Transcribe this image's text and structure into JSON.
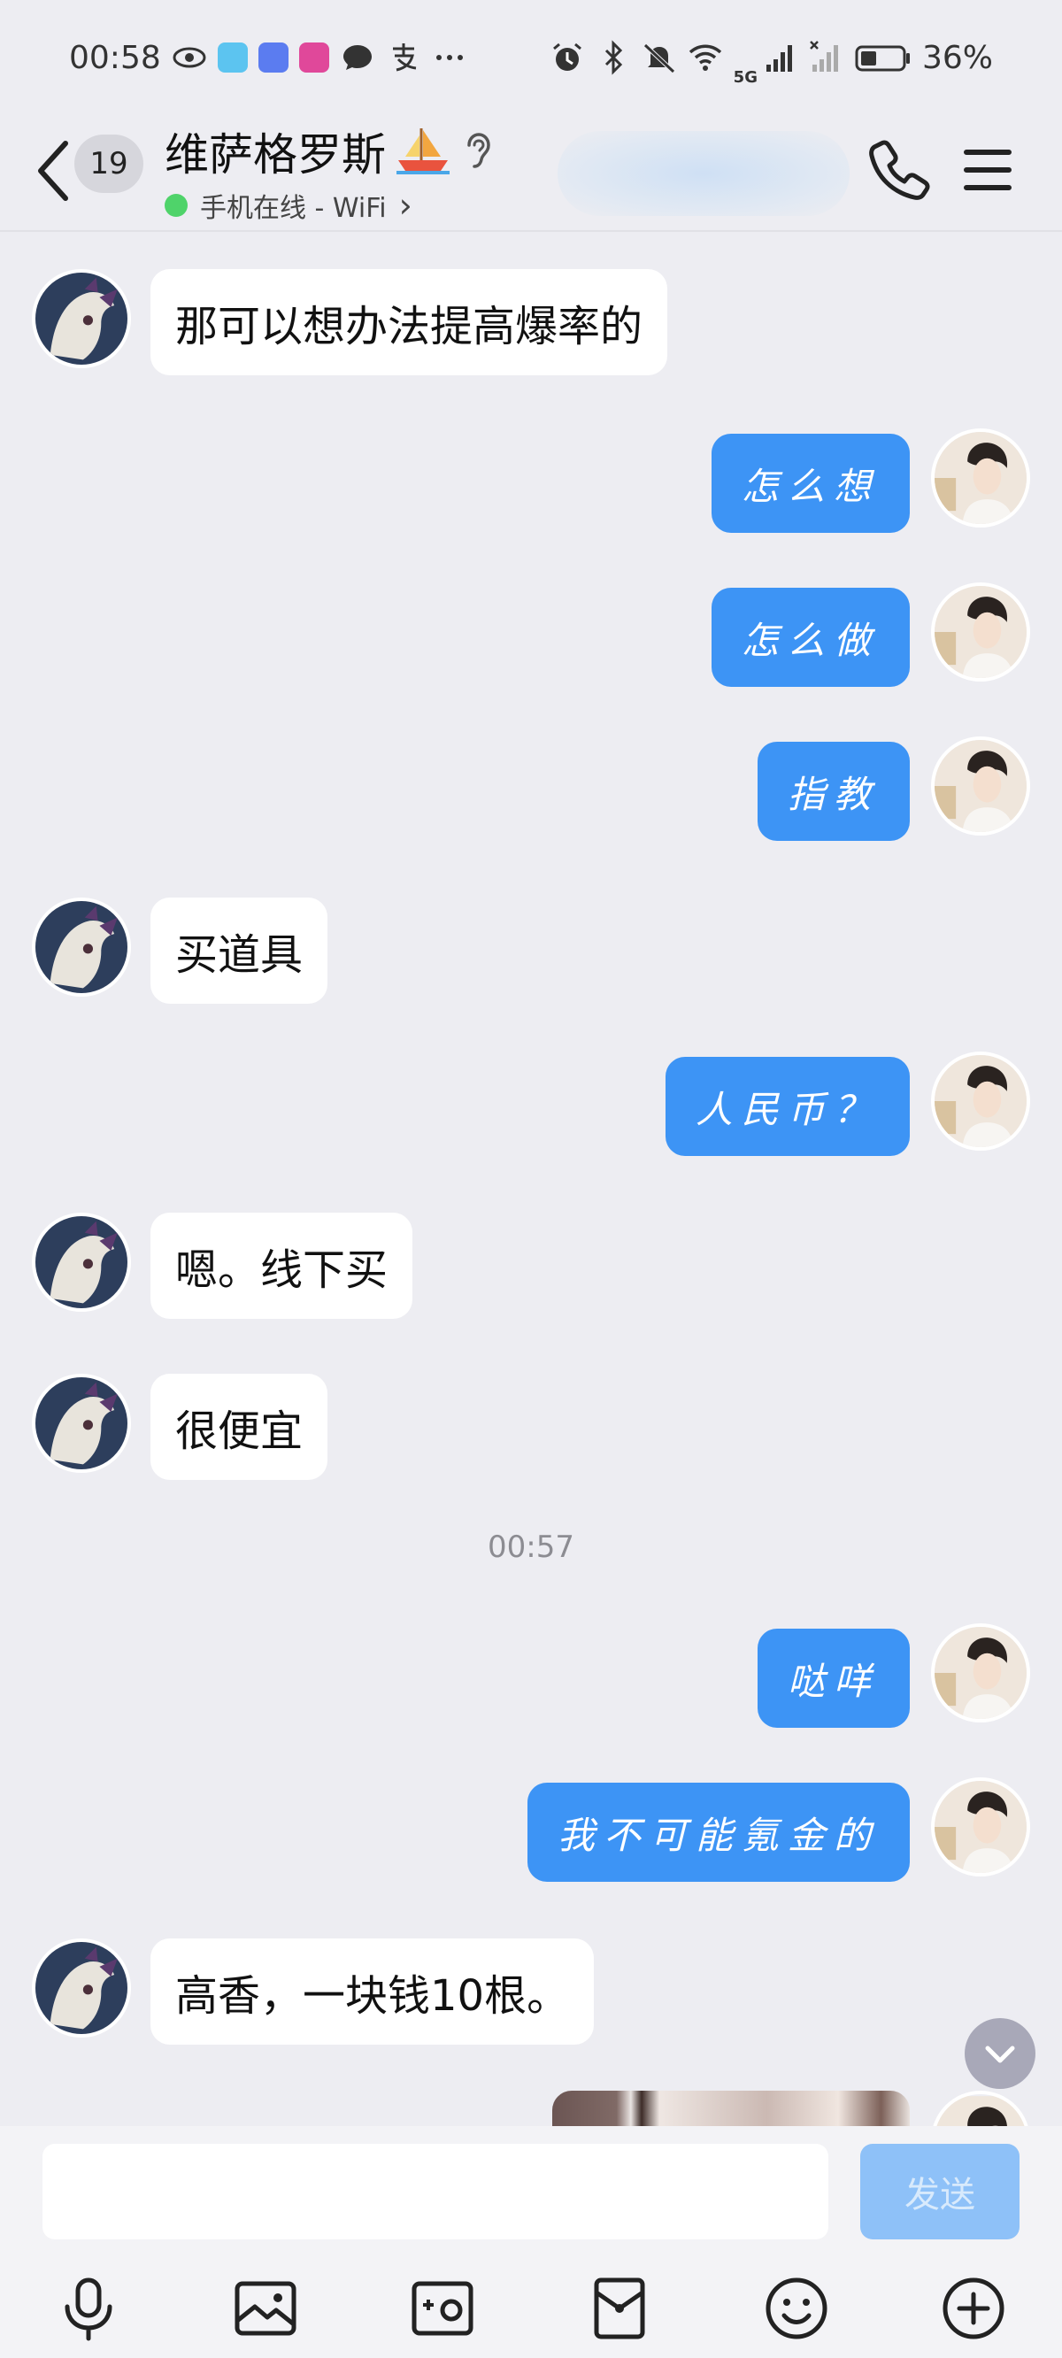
{
  "status_bar": {
    "time": "00:58",
    "battery": "36%",
    "network_label": "5G",
    "icons_left": [
      "eye-icon",
      "reader-app-icon",
      "store-app-icon",
      "video-app-icon",
      "message-icon",
      "alipay-icon",
      "more-icon"
    ],
    "icons_right": [
      "alarm-icon",
      "bluetooth-icon",
      "mute-icon",
      "wifi-icon",
      "signal-icon",
      "signal-icon-2",
      "battery-icon"
    ]
  },
  "header": {
    "unread_count": "19",
    "contact_name": "维萨格罗斯",
    "status_text": "手机在线 - WiFi",
    "status_chevron": "›"
  },
  "messages": [
    {
      "from": "them",
      "text": "那可以想办法提高爆率的"
    },
    {
      "from": "me",
      "text": "怎么想"
    },
    {
      "from": "me",
      "text": "怎么做"
    },
    {
      "from": "me",
      "text": "指教"
    },
    {
      "from": "them",
      "text": "买道具"
    },
    {
      "from": "me",
      "text": "人民币？"
    },
    {
      "from": "them",
      "text": "嗯。线下买"
    },
    {
      "from": "them",
      "text": "很便宜"
    },
    {
      "from": "time",
      "text": "00:57"
    },
    {
      "from": "me",
      "text": "哒咩"
    },
    {
      "from": "me",
      "text": "我不可能氪金的"
    },
    {
      "from": "them",
      "text": "高香，一块钱10根。"
    }
  ],
  "input": {
    "placeholder": "",
    "value": "",
    "send_label": "发送"
  },
  "toolbar": [
    "microphone-icon",
    "image-icon",
    "camera-icon",
    "red-packet-icon",
    "emoji-icon",
    "plus-icon"
  ],
  "colors": {
    "background": "#ededf2",
    "my_bubble": "#3d94f5",
    "their_bubble": "#ffffff",
    "online_dot": "#4fd36a",
    "send_button": "#8ec1f8"
  }
}
